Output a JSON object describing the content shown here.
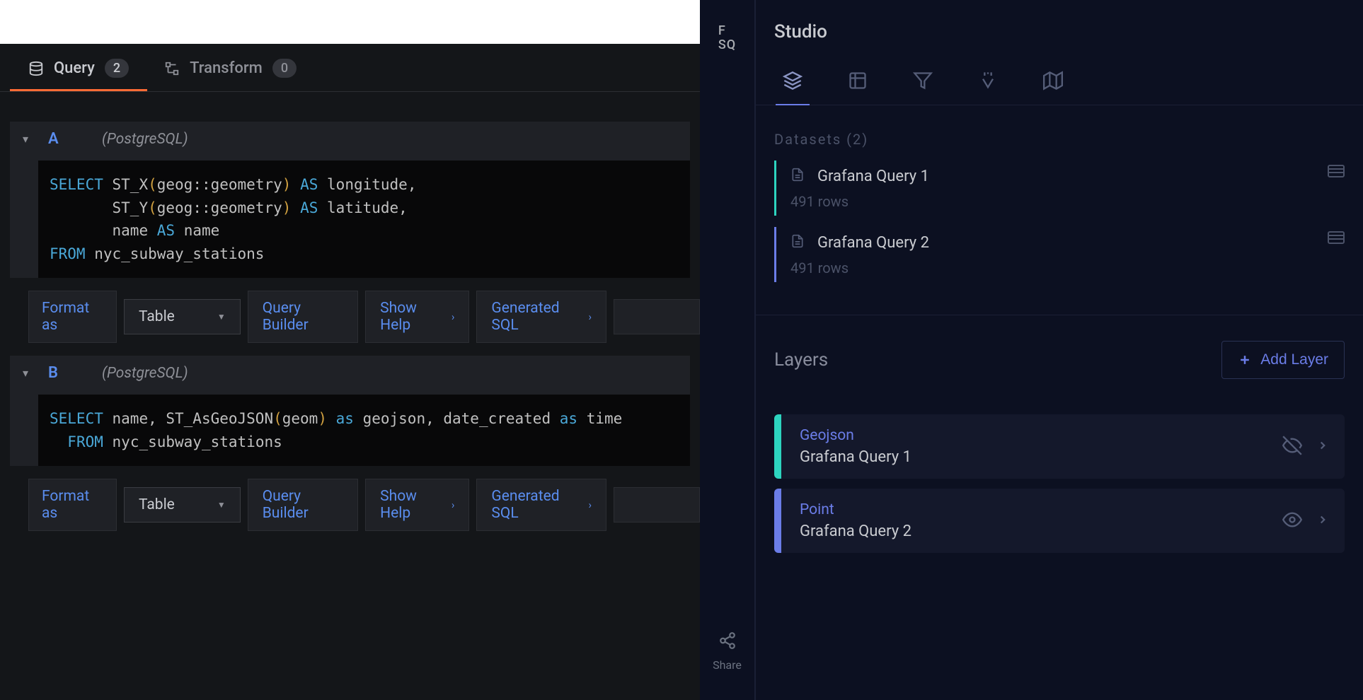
{
  "leftTabs": {
    "query": {
      "label": "Query",
      "count": "2"
    },
    "transform": {
      "label": "Transform",
      "count": "0"
    }
  },
  "queries": {
    "a": {
      "letter": "A",
      "db": "(PostgreSQL)"
    },
    "b": {
      "letter": "B",
      "db": "(PostgreSQL)"
    }
  },
  "actions": {
    "formatAs": "Format as",
    "table": "Table",
    "queryBuilder": "Query Builder",
    "showHelp": "Show Help",
    "generatedSQL": "Generated SQL"
  },
  "rail": {
    "logo1": "F",
    "logo2": "SQ",
    "share": "Share"
  },
  "studio": {
    "title": "Studio",
    "datasetsLabel": "Datasets (2)",
    "datasets": [
      {
        "name": "Grafana Query 1",
        "rows": "491 rows"
      },
      {
        "name": "Grafana Query 2",
        "rows": "491 rows"
      }
    ],
    "layersTitle": "Layers",
    "addLayer": "Add Layer",
    "layers": [
      {
        "type": "Geojson",
        "name": "Grafana Query 1"
      },
      {
        "type": "Point",
        "name": "Grafana Query 2"
      }
    ]
  }
}
